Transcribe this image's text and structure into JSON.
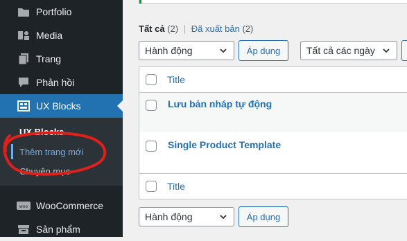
{
  "sidebar": {
    "items": [
      {
        "label": "Portfolio",
        "icon": "portfolio-icon"
      },
      {
        "label": "Media",
        "icon": "media-icon"
      },
      {
        "label": "Trang",
        "icon": "pages-icon"
      },
      {
        "label": "Phản hồi",
        "icon": "comments-icon"
      },
      {
        "label": "UX Blocks",
        "icon": "ux-blocks-icon",
        "active": true
      },
      {
        "label": "WooCommerce",
        "icon": "woocommerce-icon"
      },
      {
        "label": "Sản phẩm",
        "icon": "products-icon"
      }
    ],
    "submenu": {
      "header": "UX Blocks",
      "add_new": "Thêm trang mới",
      "categories": "Chuyên mục"
    }
  },
  "views": {
    "all_label": "Tất cả",
    "all_count": "(2)",
    "separator": "|",
    "published_label": "Đã xuất bản",
    "published_count": "(2)"
  },
  "bulk_top": {
    "select_value": "Hành động",
    "apply_label": "Áp dụng"
  },
  "date_filter": {
    "select_value": "Tất cả các ngày"
  },
  "table": {
    "header_title": "Title",
    "rows": [
      {
        "title": "Lưu bản nháp tự động"
      },
      {
        "title": "Single Product Template"
      }
    ],
    "footer_title": "Title"
  },
  "bulk_bottom": {
    "select_value": "Hành động",
    "apply_label": "Áp dụng"
  },
  "colors": {
    "sidebar_bg": "#1d2327",
    "submenu_bg": "#2c3338",
    "accent": "#2271b1",
    "annotation": "#e0201b"
  }
}
